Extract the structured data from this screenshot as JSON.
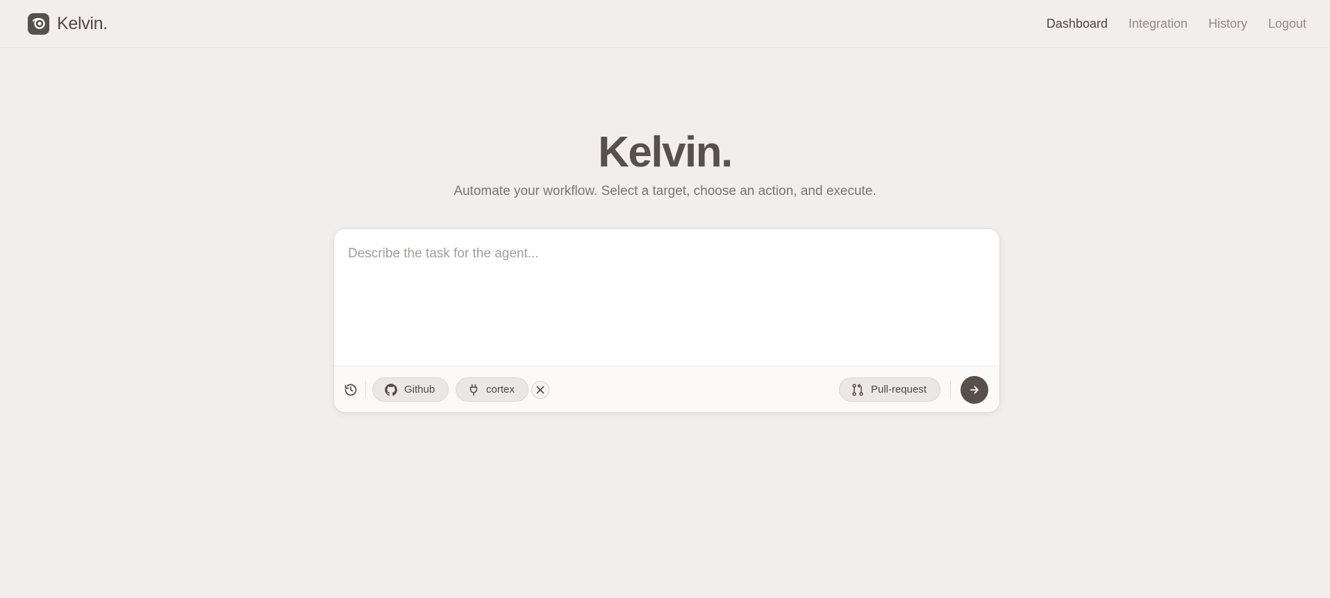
{
  "header": {
    "brand_name": "Kelvin.",
    "nav": [
      {
        "label": "Dashboard",
        "active": true
      },
      {
        "label": "Integration",
        "active": false
      },
      {
        "label": "History",
        "active": false
      },
      {
        "label": "Logout",
        "active": false
      }
    ]
  },
  "hero": {
    "title": "Kelvin.",
    "subtitle": "Automate your workflow. Select a target, choose an action, and execute."
  },
  "composer": {
    "input": {
      "value": "",
      "placeholder": "Describe the task for the agent..."
    },
    "toolbar": {
      "history_icon": "history-icon",
      "source_chip": {
        "label": "Github",
        "icon": "github-icon"
      },
      "integration_chip": {
        "label": "cortex",
        "icon": "plug-icon"
      },
      "clear_icon": "close-icon",
      "action_chip": {
        "label": "Pull-request",
        "icon": "git-pull-request-icon"
      },
      "send_icon": "arrow-right-icon"
    }
  },
  "colors": {
    "background": "#f1eeec",
    "primary": "#57504b",
    "card": "#ffffff",
    "chip": "#ebe7e5",
    "muted_text": "#938a85"
  }
}
